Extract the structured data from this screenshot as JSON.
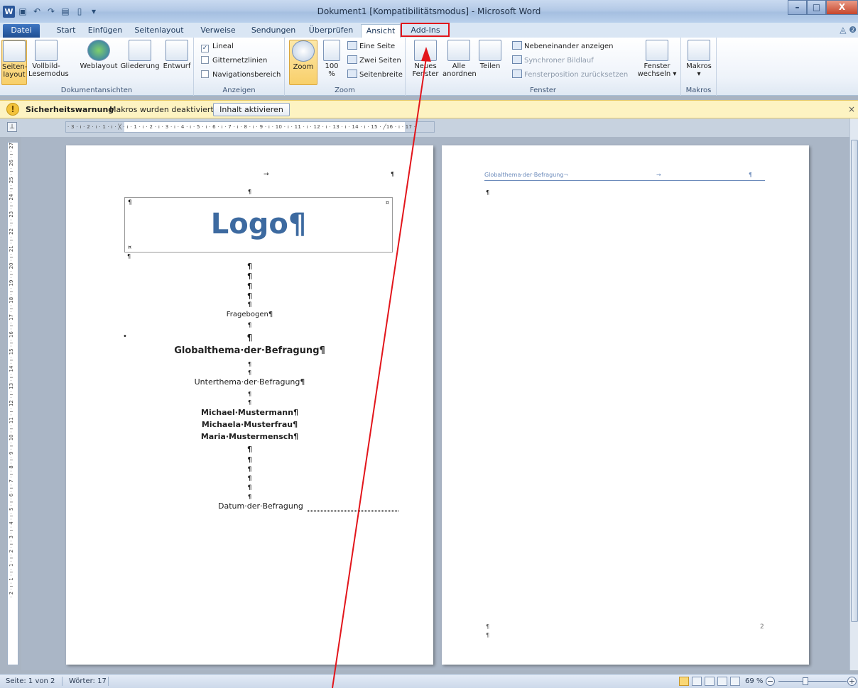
{
  "window": {
    "title": "Dokument1 [Kompatibilitätsmodus] - Microsoft Word",
    "app_icon": "W",
    "min": "–",
    "max": "□",
    "close": "X"
  },
  "tabs": {
    "file": "Datei",
    "items": [
      "Start",
      "Einfügen",
      "Seitenlayout",
      "Verweise",
      "Sendungen",
      "Überprüfen",
      "Ansicht",
      "Add-Ins"
    ],
    "active": "Ansicht",
    "highlighted": "Add-Ins"
  },
  "ribbon": {
    "dokumentansichten": {
      "label": "Dokumentansichten",
      "seitenlayout": "Seiten-\nlayout",
      "vollbild": "Vollbild-\nLesemodus",
      "weblayout": "Weblayout",
      "gliederung": "Gliederung",
      "entwurf": "Entwurf"
    },
    "anzeigen": {
      "label": "Anzeigen",
      "lineal": "Lineal",
      "gitternetzlinien": "Gitternetzlinien",
      "navigationsbereich": "Navigationsbereich",
      "lineal_checked": true
    },
    "zoom": {
      "label": "Zoom",
      "zoom": "Zoom",
      "hundert": "100\n%",
      "eine_seite": "Eine Seite",
      "zwei_seiten": "Zwei Seiten",
      "seitenbreite": "Seitenbreite"
    },
    "fenster": {
      "label": "Fenster",
      "neues_fenster": "Neues\nFenster",
      "alle_anordnen": "Alle\nanordnen",
      "teilen": "Teilen",
      "nebeneinander": "Nebeneinander anzeigen",
      "synchroner": "Synchroner Bildlauf",
      "fensterposition": "Fensterposition zurücksetzen",
      "fenster_wechseln": "Fenster\nwechseln ▾"
    },
    "makros": {
      "label": "Makros",
      "makros": "Makros\n▾"
    }
  },
  "security_bar": {
    "title": "Sicherheitswarnung",
    "message": "Makros wurden deaktiviert.",
    "button": "Inhalt aktivieren",
    "close": "×"
  },
  "ruler": {
    "horizontal": "· 3 · ı · 2 · ı · 1 · ı · ╳ · ı · 1 · ı · 2 · ı · 3 · ı · 4 · ı · 5 · ı · 6 · ı · 7 · ı · 8 · ı · 9 · ı · 10 · ı · 11 · ı · 12 · ı · 13 · ı · 14 · ı · 15 · ╱16 · ı · 17 ·",
    "vertical": "· 2 · ı · 1 · ı · 1 · ı · 2 · ı · 3 · ı · 4 · ı · 5 · ı · 6 · ı · 7 · ı · 8 · ı · 9 · ı · 10 · ı · 11 · ı · 12 · ı · 13 · ı · 14 · ı · 15 · ı · 16 · ı · 17 · ı · 18 · ı · 19 · ı · 20 · ı · 21 · ı · 22 · ı · 23 · ı · 24 · ı · 25 · ı · 26 · ı · 27"
  },
  "page1": {
    "header_tab": "→",
    "header_pilcrow": "¶",
    "pilcrow": "¶",
    "logo": "Logo¶",
    "logo_end": "¤",
    "logo_anchor": "¤",
    "fragebogen": "Fragebogen¶",
    "globalthema": "Globalthema·der·Befragung¶",
    "unterthema": "Unterthema·der·Befragung¶",
    "authors": [
      "Michael·Mustermann¶",
      "Michaela·Musterfrau¶",
      "Maria·Mustermensch¶"
    ],
    "datum": "Datum·der·Befragung"
  },
  "page2": {
    "header_text": "Globalthema·der·Befragung¬",
    "header_tab": "→",
    "header_pilcrow": "¶",
    "pilcrow": "¶",
    "page_number": "2"
  },
  "status": {
    "page": "Seite: 1 von 2",
    "words": "Wörter: 17",
    "zoom": "69 %",
    "zoom_level": 0.69,
    "minus": "−",
    "plus": "+"
  },
  "colors": {
    "highlight_red": "#e2151b",
    "logo_blue": "#3d6aa0"
  }
}
